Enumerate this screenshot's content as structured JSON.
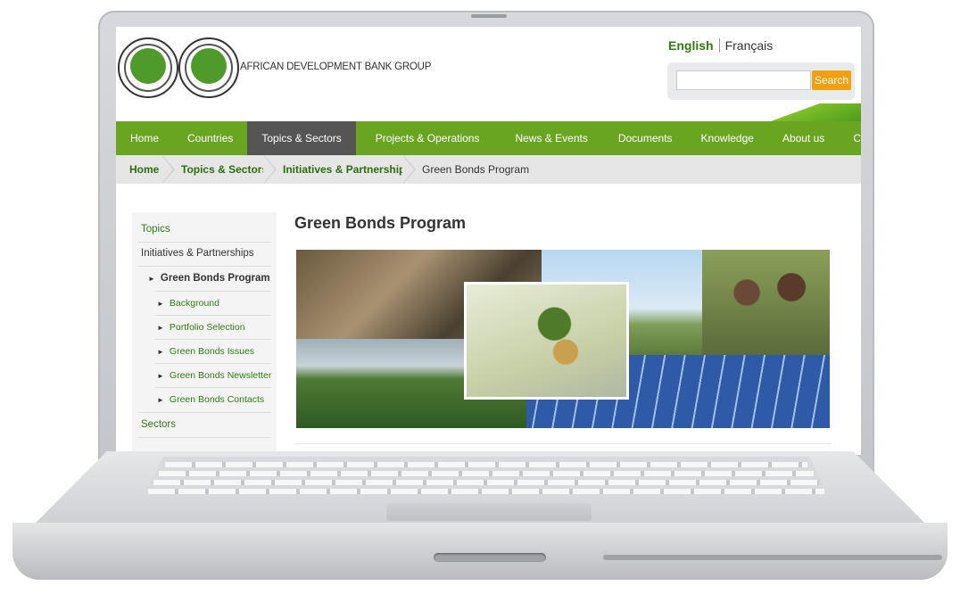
{
  "org": {
    "name": "AFRICAN DEVELOPMENT BANK GROUP"
  },
  "language": {
    "english": "English",
    "french": "Français"
  },
  "search": {
    "placeholder": "",
    "button": "Search"
  },
  "nav": [
    {
      "label": "Home",
      "active": false
    },
    {
      "label": "Countries",
      "active": false
    },
    {
      "label": "Topics & Sectors",
      "active": true
    },
    {
      "label": "Projects & Operations",
      "active": false
    },
    {
      "label": "News & Events",
      "active": false
    },
    {
      "label": "Documents",
      "active": false
    },
    {
      "label": "Knowledge",
      "active": false
    },
    {
      "label": "About us",
      "active": false
    },
    {
      "label": "Contact us",
      "active": false
    }
  ],
  "breadcrumb": [
    "Home",
    "Topics & Sectors",
    "Initiatives & Partnerships",
    "Green Bonds Program"
  ],
  "sidebar": {
    "topics": "Topics",
    "initiatives": "Initiatives & Partnerships",
    "current": "Green Bonds Program",
    "subitems": [
      "Background",
      "Portfolio Selection",
      "Green Bonds Issues",
      "Green Bonds Newsletter",
      "Green Bonds Contacts"
    ],
    "sectors": "Sectors"
  },
  "page": {
    "title": "Green Bonds Program"
  },
  "colors": {
    "nav_green": "#6aa522",
    "link_green": "#2f7d12",
    "search_orange": "#f0a010"
  }
}
